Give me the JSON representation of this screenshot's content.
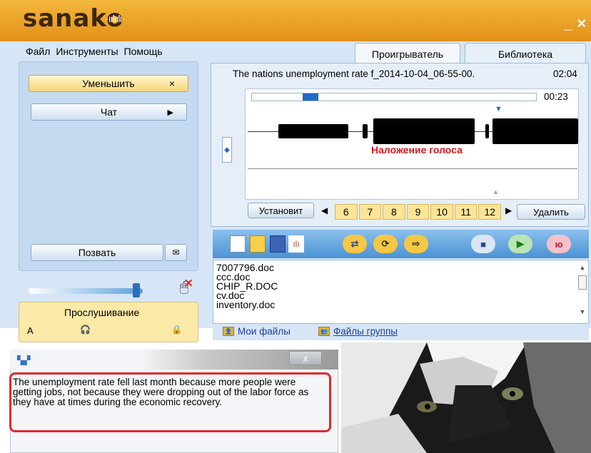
{
  "app": {
    "logo": "sanako",
    "close_glyph": "_ ×"
  },
  "menu": {
    "file": "Файл",
    "tools": "Инструменты",
    "help": "Помощь"
  },
  "left_panel": {
    "minimize_label": "Уменьшить",
    "minimize_x": "×",
    "chat_label": "Чат",
    "chat_arrow": "▶",
    "call_label": "Позвать",
    "volume_level": 0.9,
    "listen_label": "Прослушивание",
    "listen_letter": "A"
  },
  "tabs": {
    "player": "Проигрыватель",
    "library": "Библиотека"
  },
  "player": {
    "track_title": "The nations unemployment rate f_2014-10-04_06-55-00.",
    "total_time": "02:04",
    "elapsed": "00:23",
    "progress_fraction": 0.19,
    "overlay_label": "Наложение голоса",
    "set_label": "Установит",
    "delete_label": "Удалить",
    "segments": [
      "6",
      "7",
      "8",
      "9",
      "10",
      "11",
      "12"
    ]
  },
  "toolbar": {
    "stop_glyph": "■",
    "play_glyph": "▶",
    "record_label": "ю"
  },
  "files": {
    "items": [
      "7007796.doc",
      "ccc.doc",
      "CHIP_R.DOC",
      "cv.doc",
      "inventory.doc"
    ],
    "tab_my": "Мои файлы",
    "tab_group": "Файлы группы"
  },
  "dialog": {
    "close_glyph": "x",
    "text": "The unemployment rate fell last month because more people were getting jobs, not because they were dropping out of the labor force as they have at times during the economic recovery."
  },
  "colors": {
    "title_bar": "#e8a126",
    "panel": "#c4daf1",
    "accent_red": "#e0141b",
    "overlay_red": "#e02b2b"
  }
}
